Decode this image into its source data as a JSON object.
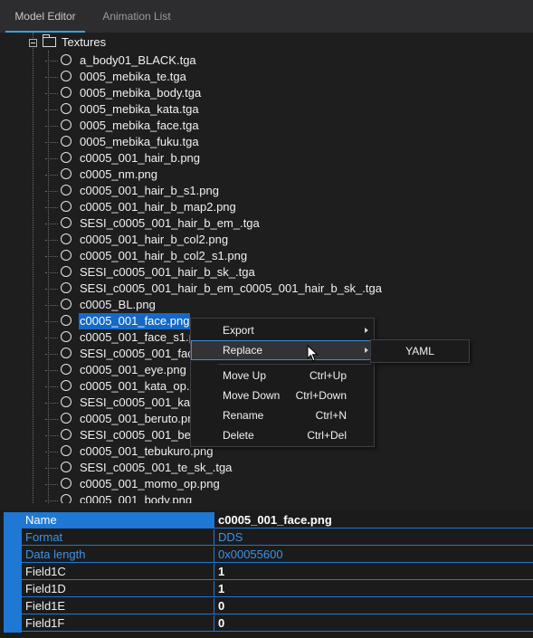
{
  "tabs": [
    "Model Editor",
    "Animation List"
  ],
  "tree": {
    "folder_label": "Textures",
    "items": [
      "a_body01_BLACK.tga",
      "0005_mebika_te.tga",
      "0005_mebika_body.tga",
      "0005_mebika_kata.tga",
      "0005_mebika_face.tga",
      "0005_mebika_fuku.tga",
      "c0005_001_hair_b.png",
      "c0005_nm.png",
      "c0005_001_hair_b_s1.png",
      "c0005_001_hair_b_map2.png",
      "SESI_c0005_001_hair_b_em_.tga",
      "c0005_001_hair_b_col2.png",
      "c0005_001_hair_b_col2_s1.png",
      "SESI_c0005_001_hair_b_sk_.tga",
      "SESI_c0005_001_hair_b_em_c0005_001_hair_b_sk_.tga",
      "c0005_BL.png",
      "c0005_001_face.png",
      "c0005_001_face_s1.p",
      "SESI_c0005_001_fac",
      "c0005_001_eye.png",
      "c0005_001_kata_op.",
      "SESI_c0005_001_ka",
      "c0005_001_beruto.pn",
      "SESI_c0005_001_be",
      "c0005_001_tebukuro.png",
      "SESI_c0005_001_te_sk_.tga",
      "c0005_001_momo_op.png",
      "c0005_001_body.png"
    ],
    "selected_index": 16
  },
  "context_menu": {
    "export_label": "Export",
    "replace_label": "Replace",
    "move_up_label": "Move Up",
    "move_up_shortcut": "Ctrl+Up",
    "move_down_label": "Move Down",
    "move_down_shortcut": "Ctrl+Down",
    "rename_label": "Rename",
    "rename_shortcut": "Ctrl+N",
    "delete_label": "Delete",
    "delete_shortcut": "Ctrl+Del"
  },
  "submenu": {
    "yaml_label": "YAML"
  },
  "properties": [
    {
      "name": "Name",
      "value": "c0005_001_face.png"
    },
    {
      "name": "Format",
      "value": "DDS"
    },
    {
      "name": "Data length",
      "value": "0x00055600"
    },
    {
      "name": "Field1C",
      "value": "1"
    },
    {
      "name": "Field1D",
      "value": "1"
    },
    {
      "name": "Field1E",
      "value": "0"
    },
    {
      "name": "Field1F",
      "value": "0"
    }
  ],
  "icons": {
    "folder": "folder-icon",
    "texture": "circle-texture-icon",
    "collapse": "collapse-toggle-icon",
    "submenu_arrow": "chevron-right-icon",
    "cursor": "mouse-pointer-icon"
  },
  "colors": {
    "background": "#1e1e1e",
    "accent": "#1e78d4",
    "selection": "#1569c7",
    "dim_text": "#3d93e6"
  }
}
